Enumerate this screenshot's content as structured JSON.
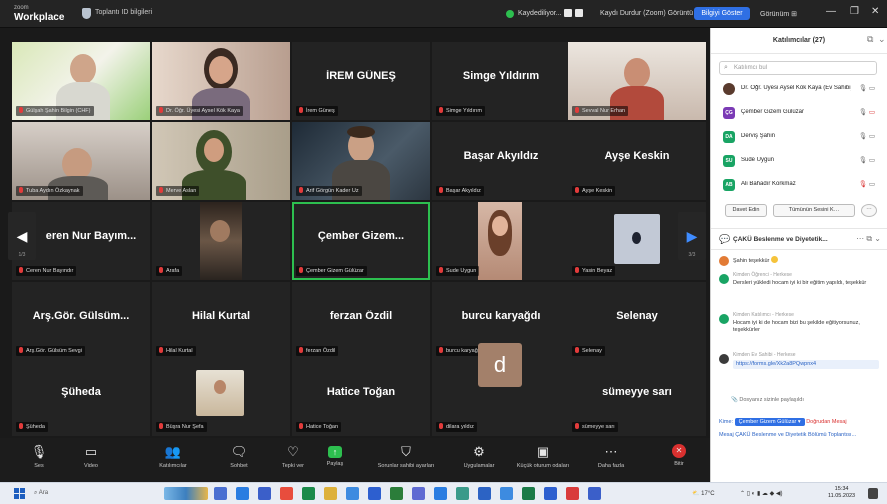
{
  "titlebar": {
    "app_small": "zoom",
    "app_name": "Workplace",
    "meeting_info": "Toplantı ID bilgileri",
    "recording": "Kaydediliyor...",
    "stop_label": "Kaydı Durdur (Zoom) Görüntü Bilgileri",
    "pill_label": "Bilgiyi Göster",
    "view_label": "Görünüm ⊞",
    "minimize": "—",
    "maximize": "❐",
    "close": "✕"
  },
  "grid": {
    "page_left": "1/3",
    "page_right": "3/3",
    "tiles": [
      {
        "name": "",
        "label": "Gülşah Şahin Bilgin (CHF)"
      },
      {
        "name": "",
        "label": "Dr. Öğr. Üyesi Aysel Kök Kaya"
      },
      {
        "name": "İREM GÜNEŞ",
        "label": "İrem Güneş"
      },
      {
        "name": "Simge Yıldırım",
        "label": "Simge Yıldırım"
      },
      {
        "name": "",
        "label": "Sevval Nur Erhan"
      },
      {
        "name": "",
        "label": "Tuba Aydın Özkaynak"
      },
      {
        "name": "",
        "label": "Merve Aslan"
      },
      {
        "name": "",
        "label": "Arif Görgün Kader Uz"
      },
      {
        "name": "Başar Akyıldız",
        "label": "Başar Akyıldız"
      },
      {
        "name": "Ayşe Keskin",
        "label": "Ayşe Keskin"
      },
      {
        "name": "eren Nur Bayım...",
        "label": "Ceren Nur Bayındır"
      },
      {
        "name": "",
        "label": "Arafa"
      },
      {
        "name": "Çember Gizem...",
        "label": "Çember Gizem Gülüzar"
      },
      {
        "name": "",
        "label": "Sude Uygun"
      },
      {
        "name": "",
        "label": "Yasin Beyaz"
      },
      {
        "name": "Arş.Gör. Gülsüm...",
        "label": "Arş.Gör. Gülsüm Sevgi"
      },
      {
        "name": "Hilal Kurtal",
        "label": "Hilal Kurtal"
      },
      {
        "name": "ferzan Özdil",
        "label": "ferzan Özdil"
      },
      {
        "name": "burcu karyağdı",
        "label": "burcu karyağdı"
      },
      {
        "name": "Selenay",
        "label": "Selenay"
      },
      {
        "name": "Şüheda",
        "label": "Şüheda"
      },
      {
        "name": "",
        "label": "Büşra Nur Şefa"
      },
      {
        "name": "Hatice Toğan",
        "label": "Hatice Toğan"
      },
      {
        "name": "",
        "label": "dilara yıldız"
      },
      {
        "name": "sümeyye sarı",
        "label": "sümeyye sarı"
      }
    ],
    "avatar_letter": "d"
  },
  "toolbar": {
    "items": [
      {
        "icon": "microphone-icon",
        "glyph": "🎙",
        "label": "Ses"
      },
      {
        "icon": "video-icon",
        "glyph": "▭",
        "label": "Video"
      },
      {
        "icon": "participants-icon",
        "glyph": "👥",
        "label": "Katılımcılar"
      },
      {
        "icon": "chat-icon",
        "glyph": "🗨",
        "label": "Sohbet"
      },
      {
        "icon": "react-icon",
        "glyph": "♡",
        "label": "Tepki ver"
      },
      {
        "icon": "share-icon",
        "glyph": "↑",
        "label": "Paylaş"
      },
      {
        "icon": "shield-icon",
        "glyph": "⛉",
        "label": "Sorunlar sahibi ayarları"
      },
      {
        "icon": "apps-icon",
        "glyph": "⚙",
        "label": "Uygulamalar"
      },
      {
        "icon": "breakout-icon",
        "glyph": "▣",
        "label": "Küçük oturum odaları"
      },
      {
        "icon": "more-icon",
        "glyph": "⋯",
        "label": "Daha fazla"
      },
      {
        "icon": "end-icon",
        "glyph": "✕",
        "label": "Bitir"
      }
    ]
  },
  "panel": {
    "title": "Katılımcılar (27)",
    "search_placeholder": "Katılımcı bul",
    "participants": [
      {
        "initials": "",
        "color": "#5a3b2e",
        "name": "Dr. Öğr. Üyesi Aysel Kök Kaya (Ev Sahibi)",
        "icons": "🎙 ▭"
      },
      {
        "initials": "ÇG",
        "color": "#7b3bb5",
        "name": "Çember Gizem Gülüzar",
        "icons": "🎙 ▭"
      },
      {
        "initials": "DA",
        "color": "#19a464",
        "name": "Derviş Şahin",
        "icons": "🎙 ▭"
      },
      {
        "initials": "SU",
        "color": "#19a464",
        "name": "Sude Uygun",
        "icons": "🎙 ▭"
      },
      {
        "initials": "AB",
        "color": "#19a464",
        "name": "Ali Bahadır Korkmaz",
        "icons": "🎙 ▭"
      }
    ],
    "invite_label": "Davet Edin",
    "mute_label": "Tümünün Sesini K…",
    "more_label": "⋯",
    "chat_title": "ÇAKÜ Beslenme ve Diyetetik...",
    "messages": [
      {
        "header": "",
        "text": "Şahin teşekkür",
        "color": "#e27b35"
      },
      {
        "header": "Kimden Öğrenci - Herkese",
        "text": "Dersleri yükledi hocam iyi ki bir eğitim yapıldı, teşekkür",
        "color": "#19a464"
      },
      {
        "header": "Kimden Katılımcı - Herkese",
        "text": "Hocam iyi ki de hocam bizi bu şekilde eğitiyorsunuz, teşekkürler",
        "color": "#19a464"
      },
      {
        "header": "Kimden Ev Sahibi - Herkese",
        "text": "https://forms.gle/Xk2a8PQwpnx4",
        "color": "#2b63c4"
      }
    ],
    "file_note": "Dosyanız sizinle paylaşıldı",
    "to_label": "Kime:",
    "to_value": "Çember Gizem Gülüzar ▾",
    "to_extra": "Doğrudan Mesaj",
    "hint": "Mesaj ÇAKÜ Beslenme ve Diyetetik Bölümü Toplantısı..."
  },
  "taskbar": {
    "search_text": "Ara",
    "tray_text": "17°C",
    "time": "15:34",
    "date": "11.05.2023"
  }
}
